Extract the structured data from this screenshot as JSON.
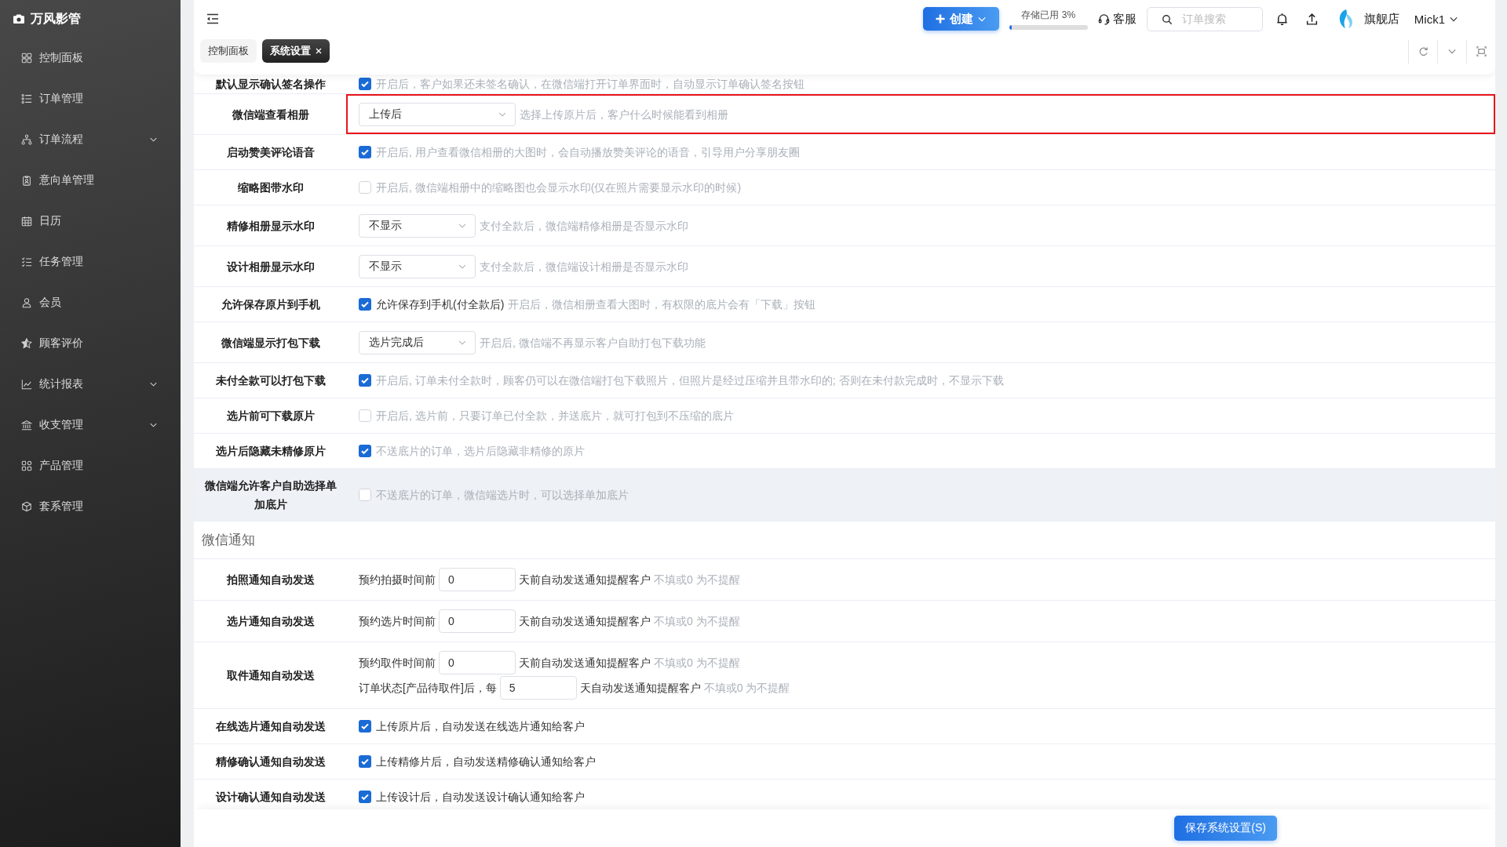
{
  "sidebar": {
    "brand": "万风影管",
    "items": [
      {
        "label": "控制面板",
        "kind": "link",
        "selected": false
      },
      {
        "label": "订单管理",
        "kind": "link",
        "selected": false
      },
      {
        "label": "订单流程",
        "kind": "group",
        "selected": false
      },
      {
        "label": "意向单管理",
        "kind": "link",
        "selected": false
      },
      {
        "label": "日历",
        "kind": "link",
        "selected": false
      },
      {
        "label": "任务管理",
        "kind": "link",
        "selected": false
      },
      {
        "label": "会员",
        "kind": "link",
        "selected": false
      },
      {
        "label": "顾客评价",
        "kind": "link",
        "selected": false
      },
      {
        "label": "统计报表",
        "kind": "group",
        "selected": false
      },
      {
        "label": "收支管理",
        "kind": "group",
        "selected": false
      },
      {
        "label": "产品管理",
        "kind": "link",
        "selected": false
      },
      {
        "label": "套系管理",
        "kind": "link",
        "selected": false
      }
    ]
  },
  "header": {
    "create_button": "创建",
    "storage": {
      "label": "存储已用 3%",
      "level": 0.03
    },
    "support": "客服",
    "search": {
      "placeholder": "订单搜索"
    },
    "shop": "旗舰店",
    "user": "Mick1"
  },
  "tabs": [
    {
      "label": "控制面板",
      "selected": false,
      "closable": false
    },
    {
      "label": "系统设置",
      "selected": true,
      "closable": true
    }
  ],
  "album_settings": {
    "rows": [
      {
        "kind": "checkbox",
        "label": "默认显示确认签名操作",
        "checked": true,
        "hint": "开启后，客户如果还未签名确认，在微信端打开订单界面时，自动显示订单确认签名按钮",
        "hovered": false,
        "highlighted": false
      },
      {
        "kind": "select",
        "label": "微信端查看相册",
        "value": "上传后",
        "hint": "选择上传原片后，客户什么时候能看到相册",
        "hovered": false,
        "highlighted": true
      },
      {
        "kind": "checkbox",
        "label": "启动赞美评论语音",
        "checked": true,
        "hint": "开启后, 用户查看微信相册的大图时，会自动播放赞美评论的语音，引导用户分享朋友圈",
        "hovered": false,
        "highlighted": false
      },
      {
        "kind": "checkbox",
        "label": "缩略图带水印",
        "checked": false,
        "hint": "开启后, 微信端相册中的缩略图也会显示水印(仅在照片需要显示水印的时候)",
        "hovered": false,
        "highlighted": false
      },
      {
        "kind": "select",
        "label": "精修相册显示水印",
        "value": "不显示",
        "hint": "支付全款后，微信端精修相册是否显示水印",
        "hovered": false,
        "highlighted": false
      },
      {
        "kind": "select",
        "label": "设计相册显示水印",
        "value": "不显示",
        "hint": "支付全款后，微信端设计相册是否显示水印",
        "hovered": false,
        "highlighted": false
      },
      {
        "kind": "checkbox",
        "label": "允许保存原片到手机",
        "checked": true,
        "option": "允许保存到手机(付全款后)",
        "hint": "开启后，微信相册查看大图时，有权限的底片会有「下载」按钮",
        "hovered": false,
        "highlighted": false
      },
      {
        "kind": "select",
        "label": "微信端显示打包下载",
        "value": "选片完成后",
        "hint": "开启后, 微信端不再显示客户自助打包下载功能",
        "hovered": false,
        "highlighted": false
      },
      {
        "kind": "checkbox",
        "label": "未付全款可以打包下载",
        "checked": true,
        "hint": "开启后, 订单未付全款时，顾客仍可以在微信端打包下载照片，但照片是经过压缩并且带水印的; 否则在未付款完成时，不显示下载",
        "hovered": false,
        "highlighted": false
      },
      {
        "kind": "checkbox",
        "label": "选片前可下载原片",
        "checked": false,
        "hint": "开启后, 选片前，只要订单已付全款，并送底片，就可打包到不压缩的底片",
        "hovered": false,
        "highlighted": false
      },
      {
        "kind": "checkbox",
        "label": "选片后隐藏未精修原片",
        "checked": true,
        "hint": "不送底片的订单，选片后隐藏非精修的原片",
        "hovered": false,
        "highlighted": false
      },
      {
        "kind": "checkbox",
        "label": "微信端允许客户自助选择单加底片",
        "checked": false,
        "hint": "不送底片的订单，微信端选片时，可以选择单加底片",
        "hovered": true,
        "highlighted": false
      }
    ]
  },
  "wechat_notice": {
    "title": "微信通知",
    "rows": [
      {
        "kind": "inputs",
        "label": "拍照通知自动发送",
        "hovered": false,
        "lines": [
          {
            "before": "预约拍摄时间前",
            "value": "0",
            "after": "天前自动发送通知提醒客户",
            "hint": "不填或0 为不提醒"
          }
        ]
      },
      {
        "kind": "inputs",
        "label": "选片通知自动发送",
        "hovered": false,
        "lines": [
          {
            "before": "预约选片时间前",
            "value": "0",
            "after": "天前自动发送通知提醒客户",
            "hint": "不填或0 为不提醒"
          }
        ]
      },
      {
        "kind": "inputs",
        "label": "取件通知自动发送",
        "hovered": false,
        "lines": [
          {
            "before": "预约取件时间前",
            "value": "0",
            "after": "天前自动发送通知提醒客户",
            "hint": "不填或0 为不提醒"
          },
          {
            "before": "订单状态[产品待取件]后，每",
            "value": "5",
            "after": "天自动发送通知提醒客户",
            "hint": "不填或0 为不提醒"
          }
        ]
      },
      {
        "kind": "checkbox",
        "label": "在线选片通知自动发送",
        "checked": true,
        "option": "上传原片后，自动发送在线选片通知给客户",
        "hovered": false
      },
      {
        "kind": "checkbox",
        "label": "精修确认通知自动发送",
        "checked": true,
        "option": "上传精修片后，自动发送精修确认通知给客户",
        "hovered": false
      },
      {
        "kind": "checkbox",
        "label": "设计确认通知自动发送",
        "checked": true,
        "option": "上传设计后，自动发送设计确认通知给客户",
        "hovered": false
      }
    ]
  },
  "footer": {
    "save_button": "保存系统设置(S)"
  }
}
